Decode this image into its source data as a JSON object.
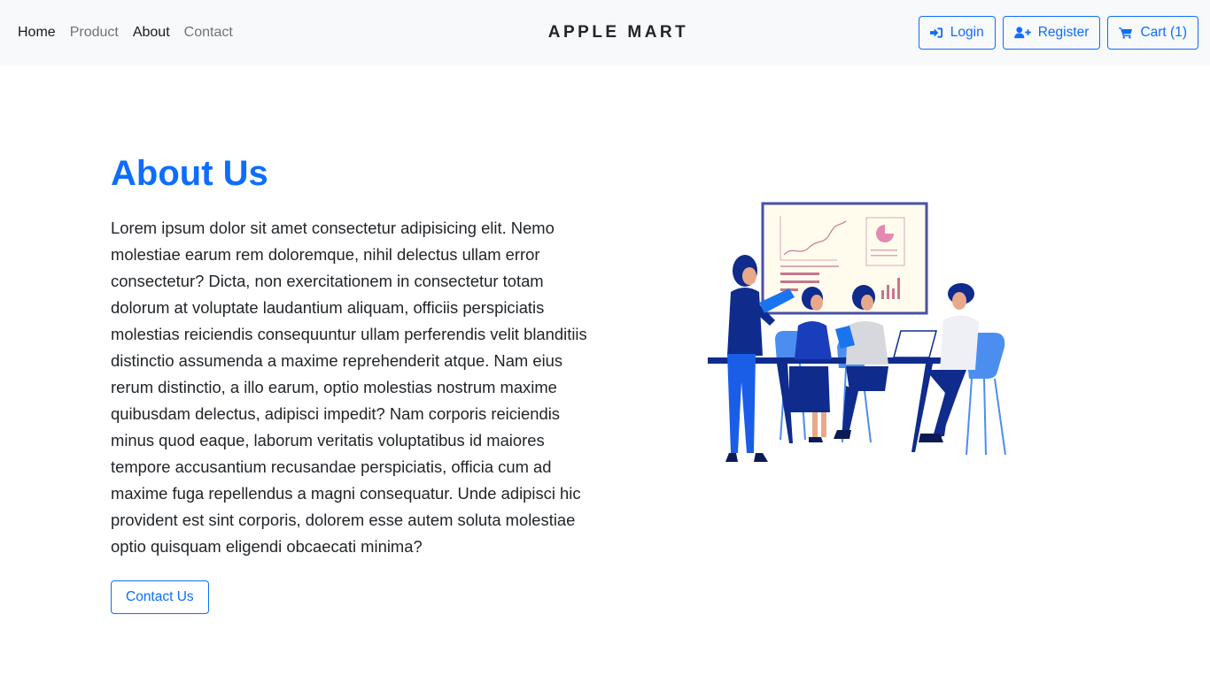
{
  "nav": {
    "links": [
      {
        "label": "Home",
        "active": true
      },
      {
        "label": "Product",
        "active": false
      },
      {
        "label": "About",
        "active": true
      },
      {
        "label": "Contact",
        "active": false
      }
    ],
    "brand": "APPLE MART",
    "actions": {
      "login": {
        "label": "Login",
        "icon": "sign-in-icon"
      },
      "register": {
        "label": "Register",
        "icon": "user-plus-icon"
      },
      "cart": {
        "label": "Cart (1)",
        "icon": "cart-icon"
      }
    }
  },
  "about": {
    "title": "About Us",
    "text": "Lorem ipsum dolor sit amet consectetur adipisicing elit. Nemo molestiae earum rem doloremque, nihil delectus ullam error consectetur? Dicta, non exercitationem in consectetur totam dolorum at voluptate laudantium aliquam, officiis perspiciatis molestias reiciendis consequuntur ullam perferendis velit blanditiis distinctio assumenda a maxime reprehenderit atque. Nam eius rerum distinctio, a illo earum, optio molestias nostrum maxime quibusdam delectus, adipisci impedit? Nam corporis reiciendis minus quod eaque, laborum veritatis voluptatibus id maiores tempore accusantium recusandae perspiciatis, officia cum ad maxime fuga repellendus a magni consequatur. Unde adipisci hic provident est sint corporis, dolorem esse autem soluta molestiae optio quisquam eligendi obcaecati minima?",
    "button": "Contact Us"
  },
  "colors": {
    "primary": "#0d6efd",
    "navbar_bg": "#f8f9fa",
    "illustration_navy": "#0f2b8c",
    "illustration_blue": "#4b8ef0"
  }
}
